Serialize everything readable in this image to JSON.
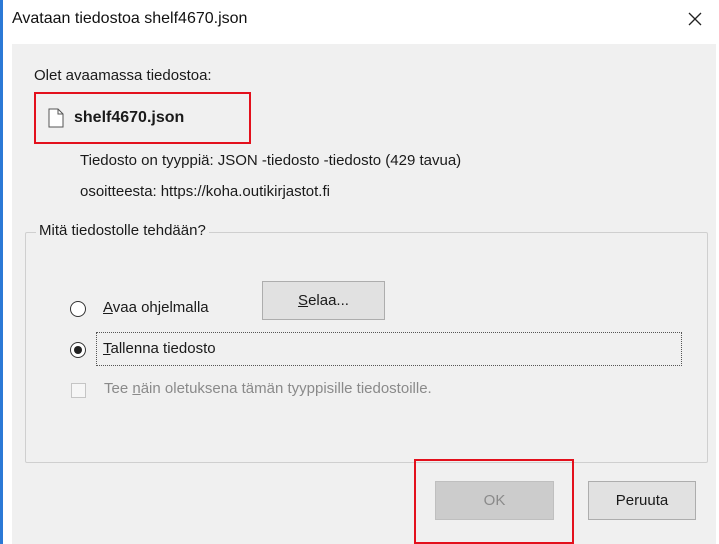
{
  "window": {
    "title": "Avataan tiedostoa shelf4670.json",
    "close_icon": "close-icon"
  },
  "dialog": {
    "intro": "Olet avaamassa tiedostoa:",
    "file_icon": "document-icon",
    "file_name": "shelf4670.json",
    "type_label": "Tiedosto on tyyppiä:",
    "type_value": "JSON -tiedosto -tiedosto (429 tavua)",
    "from_label": "osoitteesta:",
    "from_value": "https://koha.outikirjastot.fi"
  },
  "action_group": {
    "label": "Mitä tiedostolle tehdään?",
    "open_with": {
      "accel": "A",
      "rest": "vaa ohjelmalla",
      "selected": false
    },
    "browse_button": {
      "accel": "S",
      "rest": "elaa..."
    },
    "save_file": {
      "accel": "T",
      "rest": "allenna tiedosto",
      "selected": true
    },
    "default_checkbox": {
      "pre": "Tee ",
      "accel": "n",
      "rest": "äin oletuksena tämän tyyppisille tiedostoille.",
      "checked": false,
      "enabled": false
    }
  },
  "buttons": {
    "ok": "OK",
    "cancel": "Peruuta"
  },
  "colors": {
    "highlight_border": "#e3101c",
    "dialog_bg": "#f0f0f0",
    "title_bg": "#ffffff",
    "accent_edge": "#2b79d6"
  }
}
